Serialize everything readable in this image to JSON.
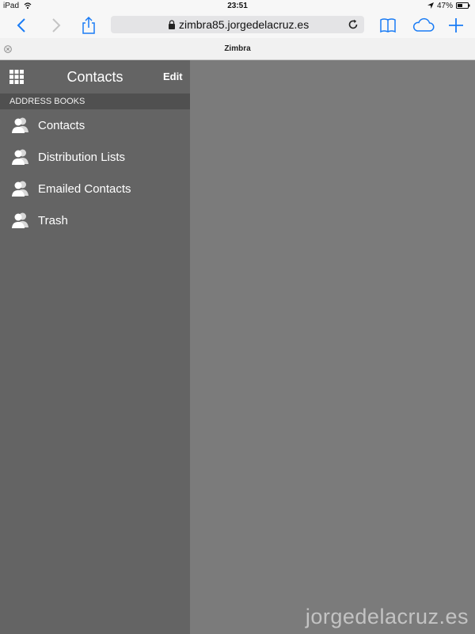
{
  "status_bar": {
    "device": "iPad",
    "time": "23:51",
    "battery": "47%"
  },
  "browser": {
    "url": "zimbra85.jorgedelacruz.es",
    "tab_title": "Zimbra",
    "accent_color": "#1a7cf5"
  },
  "sidebar": {
    "title": "Contacts",
    "edit_label": "Edit",
    "section_header": "ADDRESS BOOKS",
    "items": [
      {
        "label": "Contacts"
      },
      {
        "label": "Distribution Lists"
      },
      {
        "label": "Emailed Contacts"
      },
      {
        "label": "Trash"
      }
    ]
  },
  "watermark": "jorgedelacruz.es"
}
